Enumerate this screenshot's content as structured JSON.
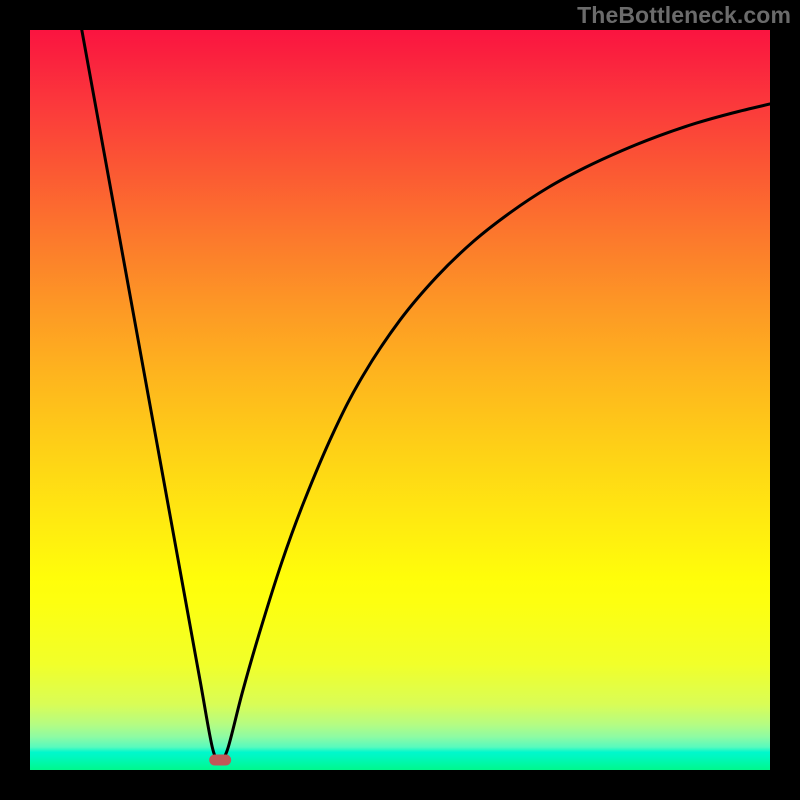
{
  "watermark": "TheBottleneck.com",
  "chart_data": {
    "type": "line",
    "title": "",
    "xlabel": "",
    "ylabel": "",
    "xlim": [
      0,
      1
    ],
    "ylim": [
      0,
      1
    ],
    "annotations": [],
    "background_gradient": {
      "top_color": "#fa1440",
      "bottom_color": "#00f88c",
      "mid_color": "#fffd0a",
      "direction": "vertical"
    },
    "notch_marker": {
      "x": 0.257,
      "y": 0.0135,
      "color": "#c05858",
      "note": "bottleneck minimum point indicator"
    },
    "series": [
      {
        "name": "left-branch",
        "note": "piecewise, descending steeply from top-left to notch",
        "x": [
          0.07,
          0.09,
          0.11,
          0.13,
          0.15,
          0.17,
          0.19,
          0.21,
          0.23,
          0.247,
          0.257
        ],
        "values": [
          1.0,
          0.89,
          0.78,
          0.67,
          0.56,
          0.45,
          0.34,
          0.23,
          0.12,
          0.028,
          0.0135
        ]
      },
      {
        "name": "right-branch",
        "note": "piecewise, rising concavely from notch toward upper right",
        "x": [
          0.257,
          0.267,
          0.287,
          0.31,
          0.34,
          0.37,
          0.41,
          0.45,
          0.5,
          0.55,
          0.6,
          0.65,
          0.7,
          0.75,
          0.8,
          0.85,
          0.9,
          0.95,
          1.0
        ],
        "values": [
          0.0135,
          0.028,
          0.105,
          0.185,
          0.28,
          0.362,
          0.456,
          0.533,
          0.608,
          0.667,
          0.715,
          0.754,
          0.787,
          0.814,
          0.837,
          0.857,
          0.874,
          0.888,
          0.9
        ]
      }
    ]
  }
}
